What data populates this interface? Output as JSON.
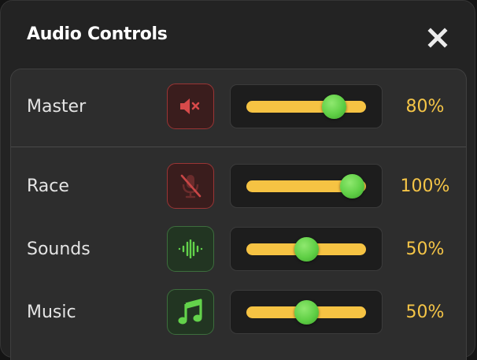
{
  "window": {
    "title": "Audio Controls",
    "close_icon": "close-icon"
  },
  "colors": {
    "accent": "#f6c343",
    "thumb": "#5fcf45",
    "muted": "#d84a4a",
    "active": "#63d24b"
  },
  "channels": [
    {
      "label": "Master",
      "percent_label": "80%",
      "value": 0.8,
      "icon": "speaker-muted-icon",
      "state": "muted"
    },
    {
      "label": "Race",
      "percent_label": "100%",
      "value": 1.0,
      "icon": "microphone-muted-icon",
      "state": "muted"
    },
    {
      "label": "Sounds",
      "percent_label": "50%",
      "value": 0.5,
      "icon": "sound-wave-icon",
      "state": "active"
    },
    {
      "label": "Music",
      "percent_label": "50%",
      "value": 0.5,
      "icon": "music-note-icon",
      "state": "active"
    }
  ]
}
